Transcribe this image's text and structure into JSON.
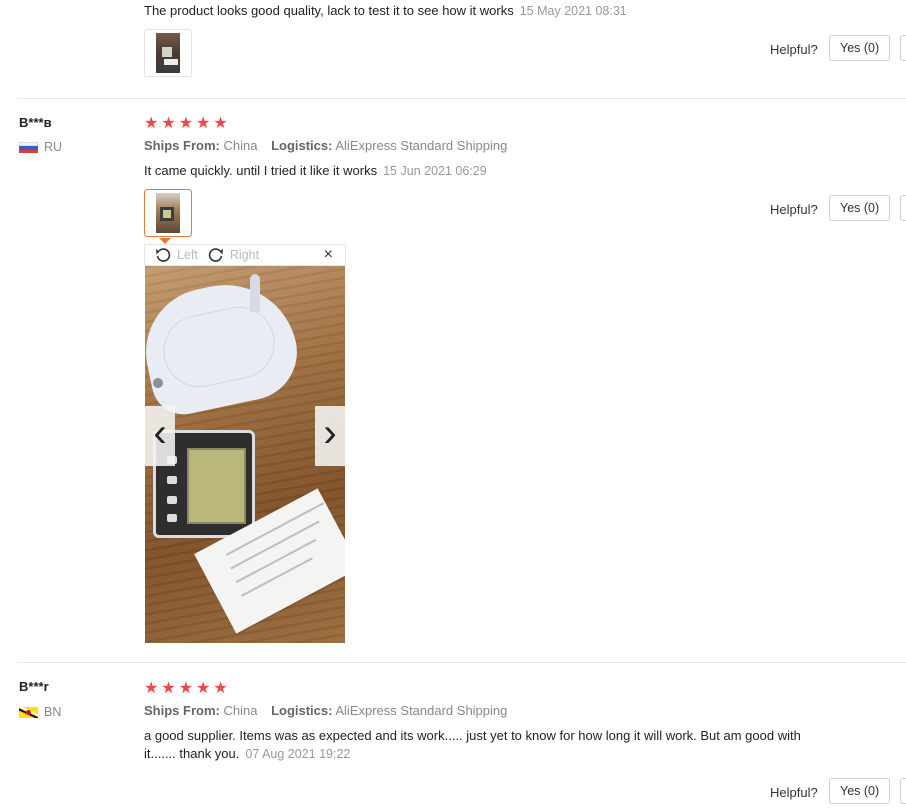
{
  "reviews": [
    {
      "text": "The product looks good quality, lack to test it to see how it works",
      "date": "15 May 2021 08:31",
      "helpful_label": "Helpful?",
      "yes_label": "Yes (0)"
    },
    {
      "author": "B***в",
      "country": "RU",
      "rating": 5,
      "ships_from_label": "Ships From:",
      "ships_from": "China",
      "logistics_label": "Logistics:",
      "logistics": "AliExpress Standard Shipping",
      "text": "It came quickly. until I tried it like it works",
      "date": "15 Jun 2021 06:29",
      "helpful_label": "Helpful?",
      "yes_label": "Yes (0)"
    },
    {
      "author": "B***r",
      "country": "BN",
      "rating": 5,
      "ships_from_label": "Ships From:",
      "ships_from": "China",
      "logistics_label": "Logistics:",
      "logistics": "AliExpress Standard Shipping",
      "text_line1": "a good supplier. Items was as expected and its work..... just yet to know for how long it will work. But am good with",
      "text_line2": "it....... thank you.",
      "date": "07 Aug 2021 19:22",
      "helpful_label": "Helpful?",
      "yes_label": "Yes (0)"
    }
  ],
  "viewer": {
    "rotate_left_label": "Left",
    "rotate_right_label": "Right",
    "close_symbol": "×",
    "prev_symbol": "‹",
    "next_symbol": "›"
  },
  "colors": {
    "star": "#f04848",
    "active_thumb_border": "#e07b39"
  }
}
